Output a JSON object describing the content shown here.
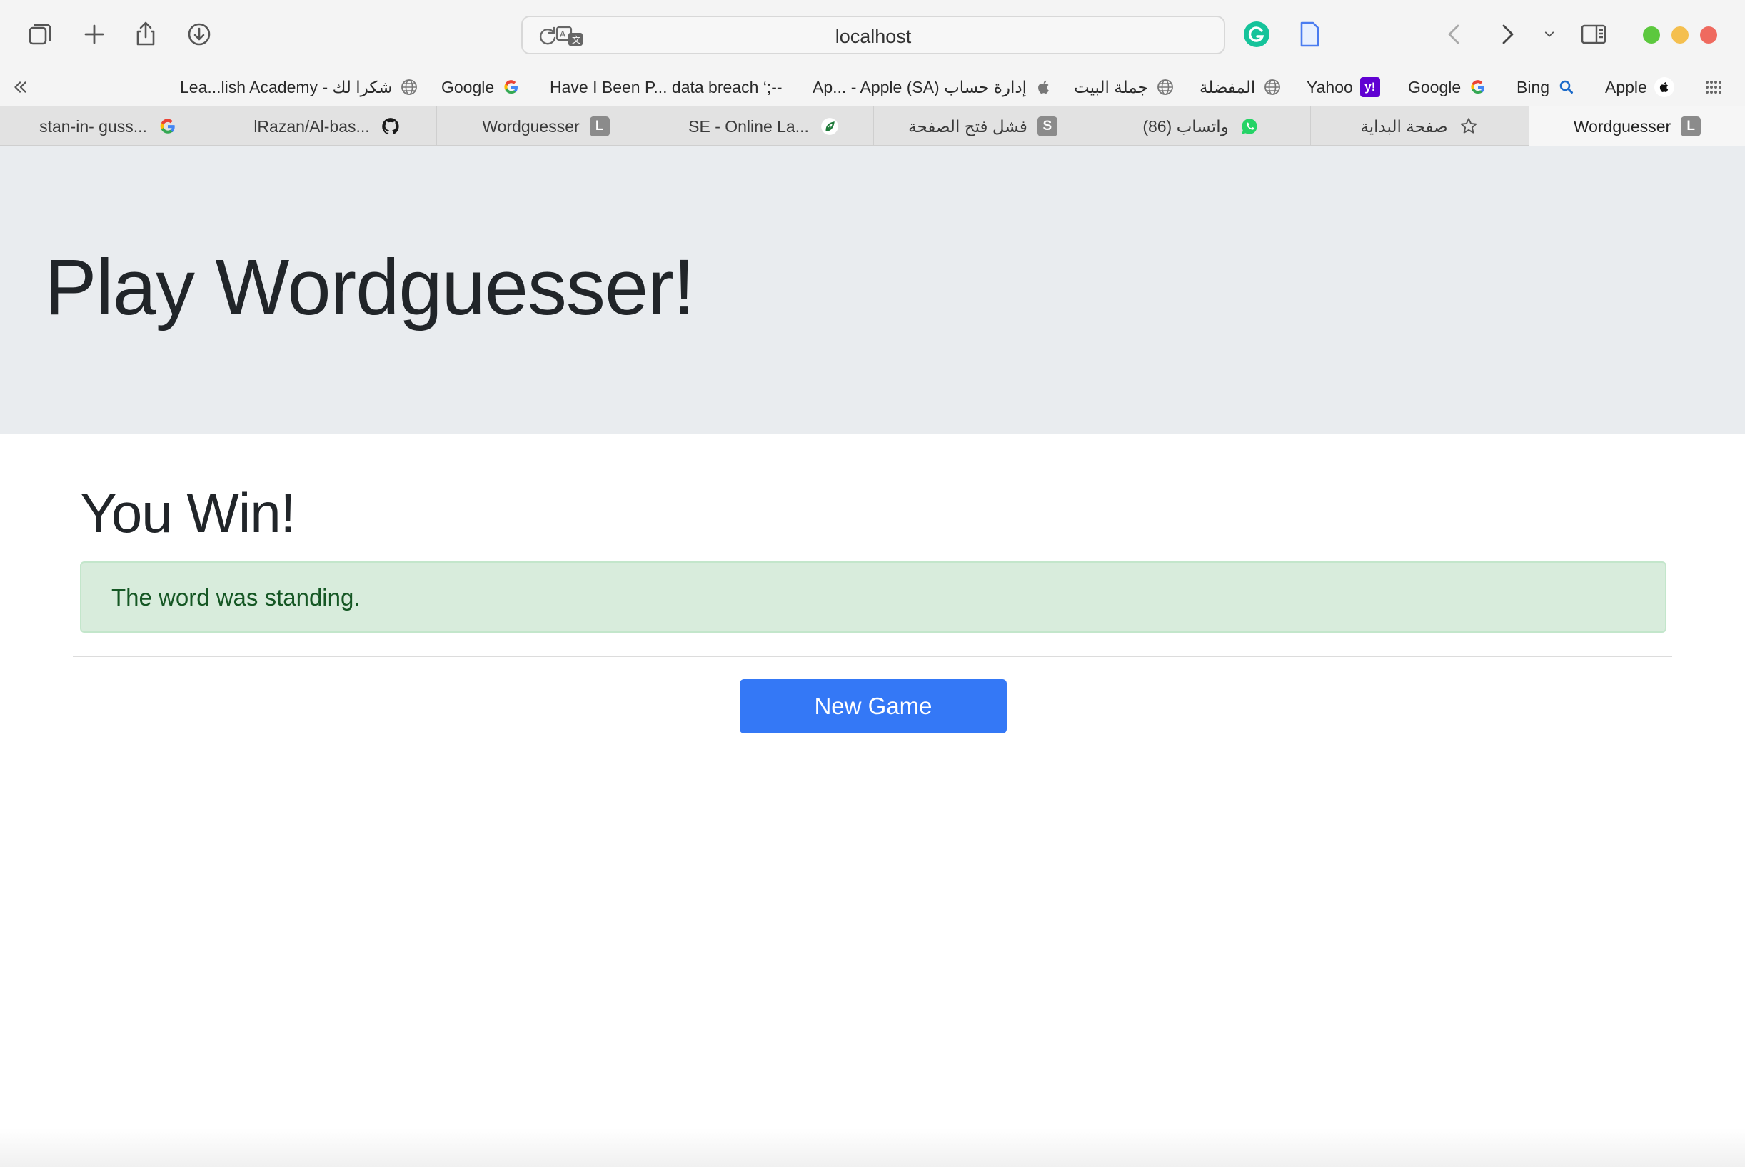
{
  "browser": {
    "url": "localhost",
    "bookmarks": [
      {
        "label": "Lea...lish Academy - شكرا لك",
        "icon": "globe-icon"
      },
      {
        "label": "Google",
        "icon": "google-icon"
      },
      {
        "label": "Have I Been P... data breach ‘;--",
        "icon": ""
      },
      {
        "label": "Ap... - Apple (SA) إدارة حساب",
        "icon": "apple-icon"
      },
      {
        "label": "جملة البيت",
        "icon": "globe-icon"
      },
      {
        "label": "المفضلة",
        "icon": "globe-icon"
      },
      {
        "label": "Yahoo",
        "icon": "yahoo-icon"
      },
      {
        "label": "Google",
        "icon": "google-icon"
      },
      {
        "label": "Bing",
        "icon": "bing-icon"
      },
      {
        "label": "Apple",
        "icon": "apple-icon"
      }
    ],
    "tabs": [
      {
        "label": "stan-in- guss...",
        "icon": "google-icon"
      },
      {
        "label": "lRazan/Al-bas...",
        "icon": "github-icon"
      },
      {
        "label": "Wordguesser",
        "icon": "L"
      },
      {
        "label": "SE - Online La...",
        "icon": "leaf-icon"
      },
      {
        "label": "فشل فتح الصفحة",
        "icon": "S"
      },
      {
        "label": "(86) واتساب",
        "icon": "whatsapp-icon"
      },
      {
        "label": "صفحة البداية",
        "icon": "star-icon"
      },
      {
        "label": "Wordguesser",
        "icon": "L"
      }
    ],
    "yahoo_badge": "y!"
  },
  "page": {
    "heading": "Play Wordguesser!",
    "result_title": "You Win!",
    "message": "The word was standing.",
    "new_game_label": "New Game"
  },
  "colors": {
    "primary_button": "#3478f6",
    "alert_bg": "#d8ecdc",
    "alert_text": "#155724",
    "jumbotron_bg": "#e9ecef"
  }
}
